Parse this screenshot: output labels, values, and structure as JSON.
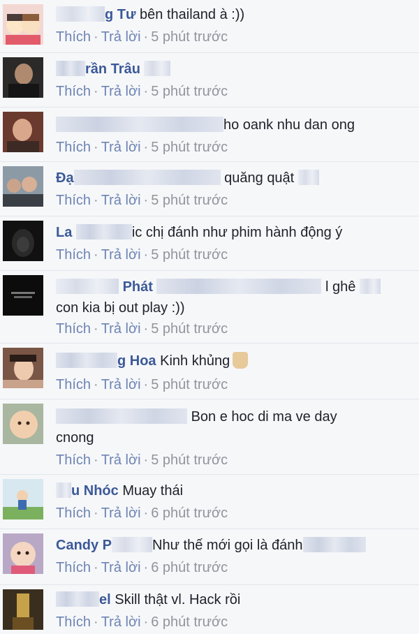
{
  "actions": {
    "like": "Thích",
    "reply": "Trả lời",
    "dot": "·"
  },
  "comments": [
    {
      "author_visible": "g Tư",
      "text": "bên thailand à :))",
      "time": "5 phút trước"
    },
    {
      "author_visible": "rần Trâu",
      "text": "",
      "time": "5 phút trước"
    },
    {
      "author_visible": "",
      "text": "ho oank nhu dan ong",
      "time": "5 phút trước"
    },
    {
      "author_visible": "Đạ",
      "text": "quăng quật",
      "time": "5 phút trước"
    },
    {
      "author_visible": "La",
      "text": "ic chị đánh như phim hành động ý",
      "time": "5 phút trước"
    },
    {
      "author_visible": "Phát",
      "text": "l ghê",
      "text2": "con kia bị out play :))",
      "time": "5 phút trước"
    },
    {
      "author_visible": "g Hoa",
      "text": "Kinh khủng",
      "time": "5 phút trước"
    },
    {
      "author_visible": "",
      "text": "Bon e hoc di ma ve day",
      "text2": "cnong",
      "time": "5 phút trước"
    },
    {
      "author_visible": "u Nhóc",
      "text": "Muay thái",
      "time": "6 phút trước"
    },
    {
      "author_visible": "Candy P",
      "text": "Như thế mới gọi là đánh",
      "time": "6 phút trước"
    },
    {
      "author_visible": "el",
      "text": "Skill thật vl. Hack rồi",
      "time": "6 phút trước"
    }
  ]
}
